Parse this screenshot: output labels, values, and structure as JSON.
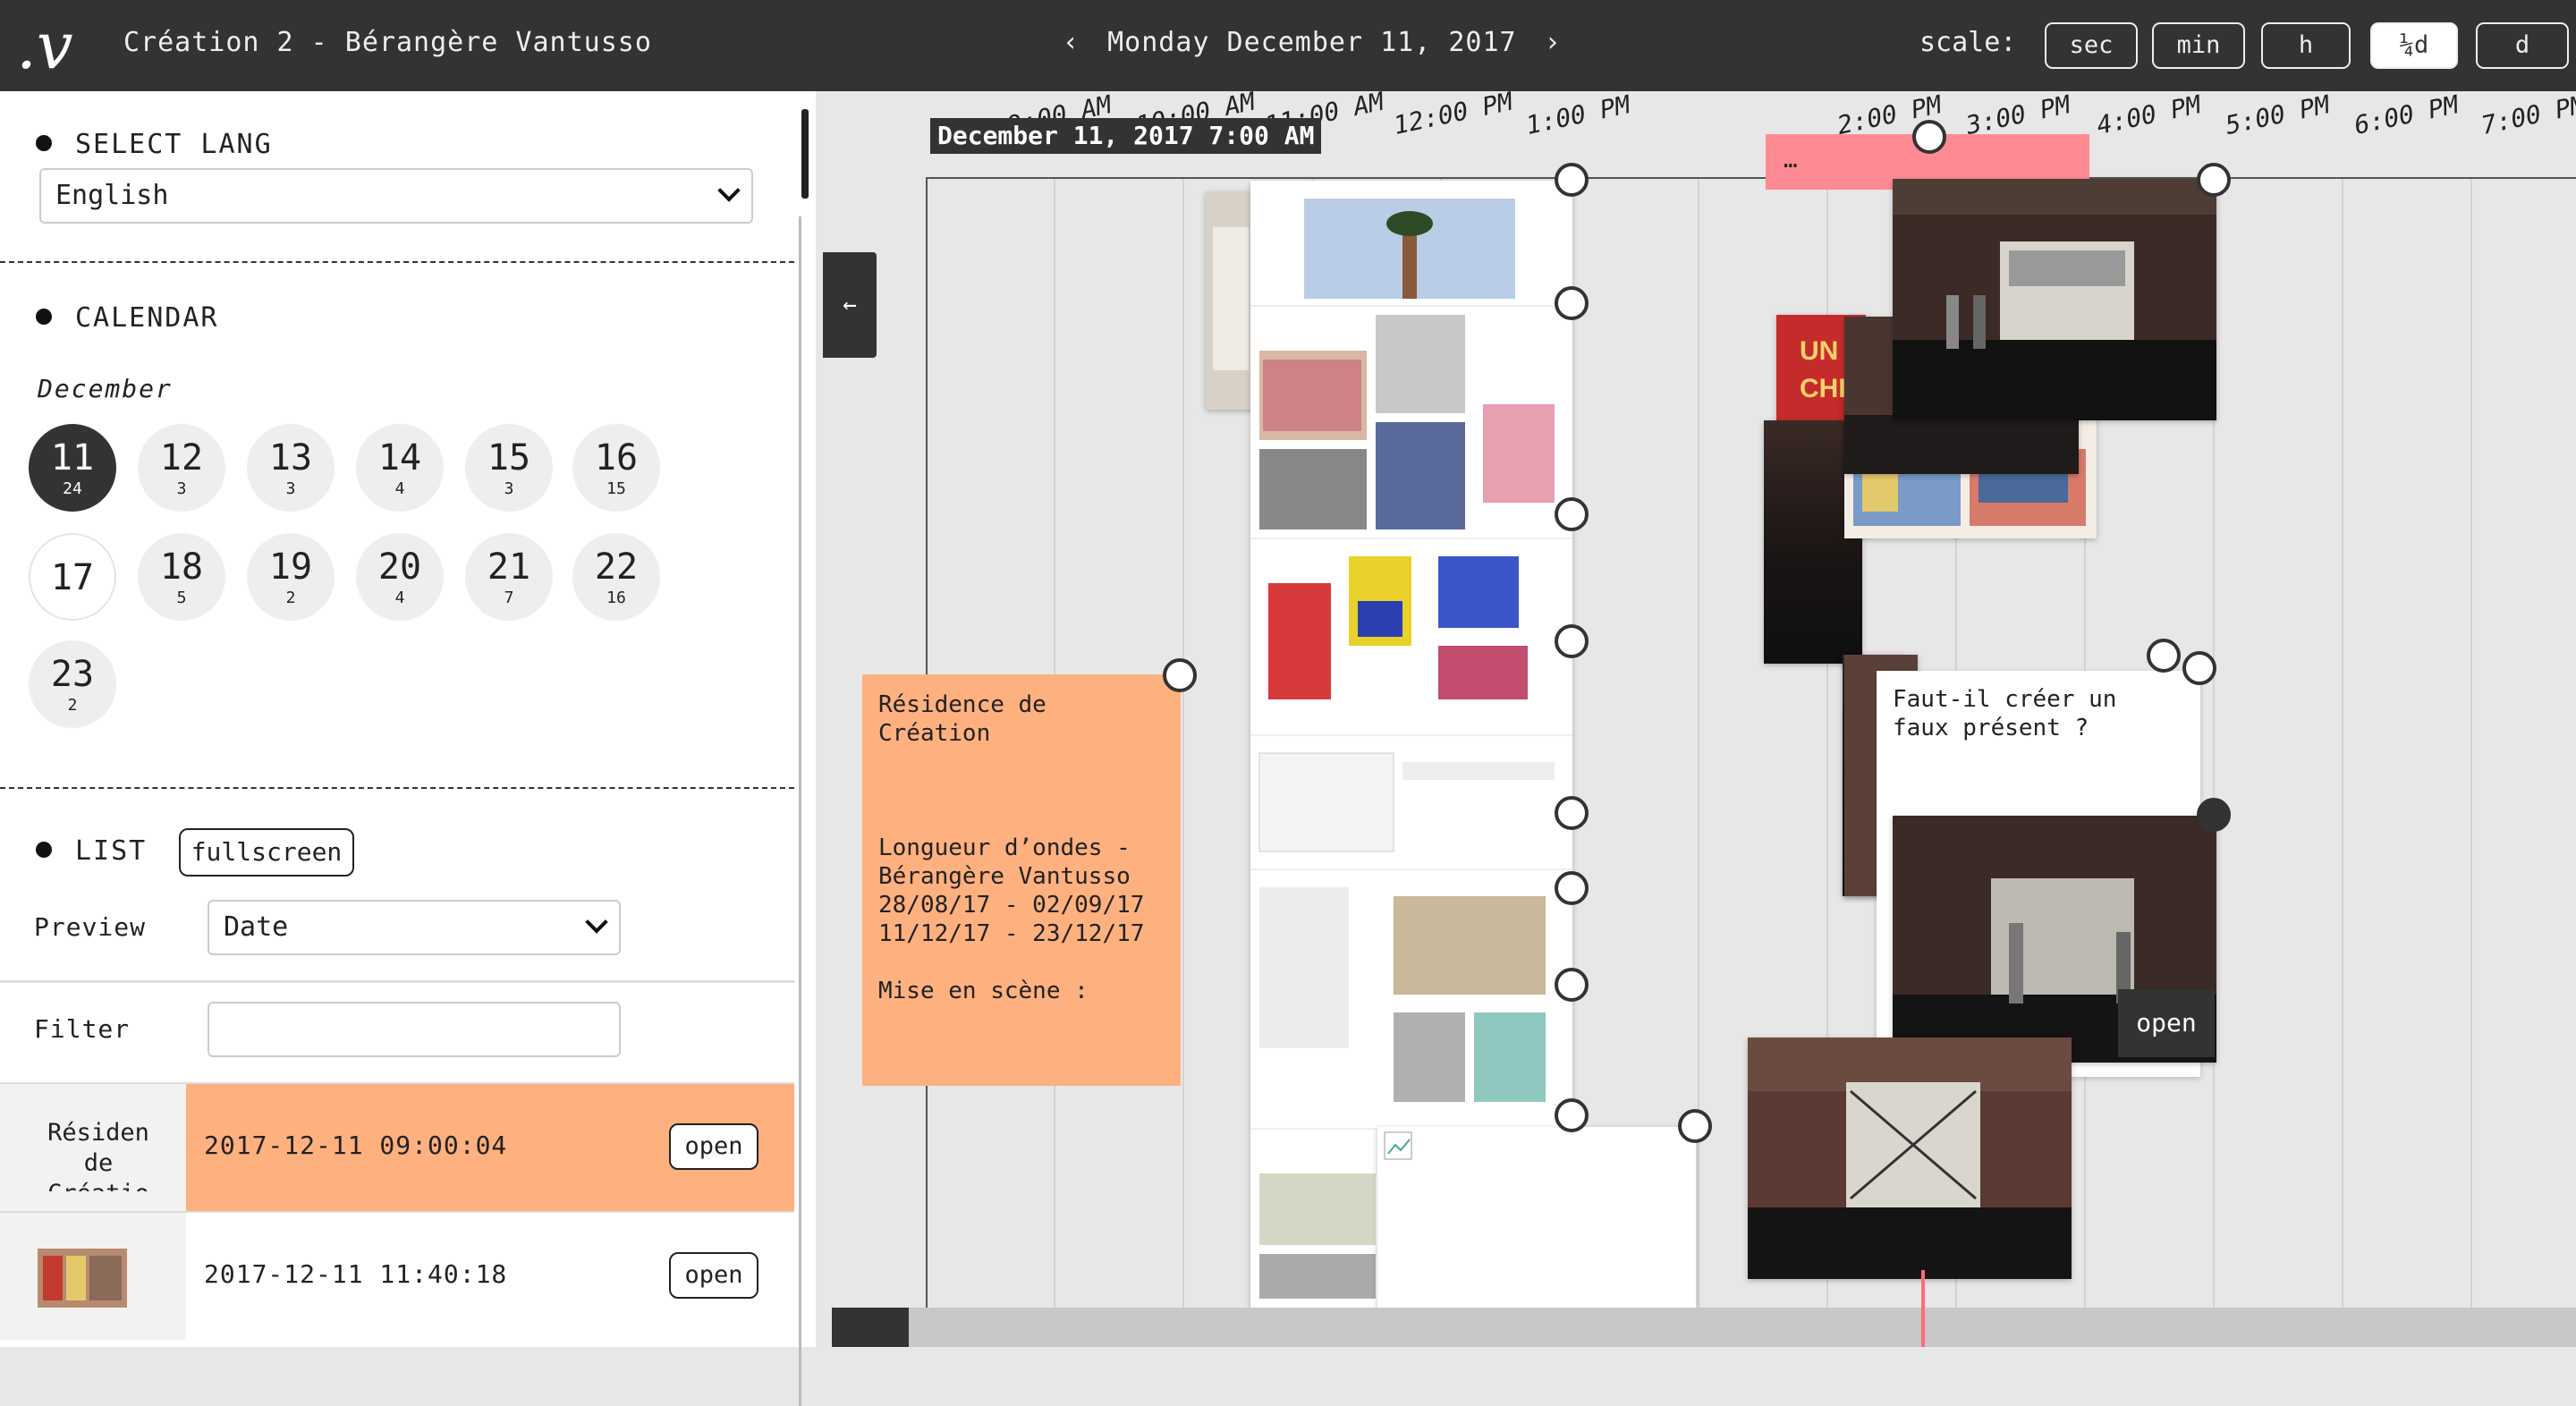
{
  "header": {
    "logo": ".v",
    "title": "Création 2 - Bérangère Vantusso",
    "prev_icon": "‹",
    "date": "Monday December 11, 2017",
    "next_icon": "›",
    "scale_label": "scale:",
    "scales": [
      "sec",
      "min",
      "h",
      "¼d",
      "d"
    ],
    "active_scale": "¼d"
  },
  "sidebar": {
    "lang": {
      "heading": "SELECT LANG",
      "value": "English"
    },
    "calendar": {
      "heading": "CALENDAR",
      "month": "December",
      "days": [
        {
          "day": "11",
          "count": "24",
          "selected": true
        },
        {
          "day": "12",
          "count": "3"
        },
        {
          "day": "13",
          "count": "3"
        },
        {
          "day": "14",
          "count": "4"
        },
        {
          "day": "15",
          "count": "3"
        },
        {
          "day": "16",
          "count": "15"
        },
        {
          "day": "17",
          "count": ""
        },
        {
          "day": "18",
          "count": "5"
        },
        {
          "day": "19",
          "count": "2"
        },
        {
          "day": "20",
          "count": "4"
        },
        {
          "day": "21",
          "count": "7"
        },
        {
          "day": "22",
          "count": "16"
        },
        {
          "day": "23",
          "count": "2"
        }
      ]
    },
    "list": {
      "heading": "LIST",
      "fullscreen_label": "fullscreen",
      "preview_label": "Preview",
      "preview_value": "Date",
      "filter_label": "Filter",
      "filter_value": "",
      "rows": [
        {
          "title": "Résiden de Créatio",
          "date": "2017-12-11 09:00:04",
          "open": "open",
          "highlight": true
        },
        {
          "title": "",
          "date": "2017-12-11 11:40:18",
          "open": "open",
          "highlight": false
        }
      ]
    }
  },
  "timeline": {
    "cursor": "December 11, 2017 7:00 AM",
    "back_icon": "←",
    "ticks": [
      "9:00 AM",
      "10:00 AM",
      "11:00 AM",
      "12:00 PM",
      "1:00 PM",
      "2:00 PM",
      "3:00 PM",
      "4:00 PM",
      "5:00 PM",
      "6:00 PM",
      "7:00 PM"
    ],
    "note_text": "Résidence de\nCréation\n\n\n\nLongueur d’ondes -\nBérangère Vantusso\n28/08/17 - 02/09/17\n11/12/17 - 23/12/17\n\nMise en scène :",
    "pink_note": "…",
    "question_note": "Faut-il créer un\nfaux présent ?",
    "open_label": "open",
    "poster_text": "UN M\nCHI",
    "colors": {
      "note": "#ffb07f",
      "pink": "#ff8a94",
      "dark": "#333333",
      "row_highlight": "#ffb07f"
    }
  }
}
